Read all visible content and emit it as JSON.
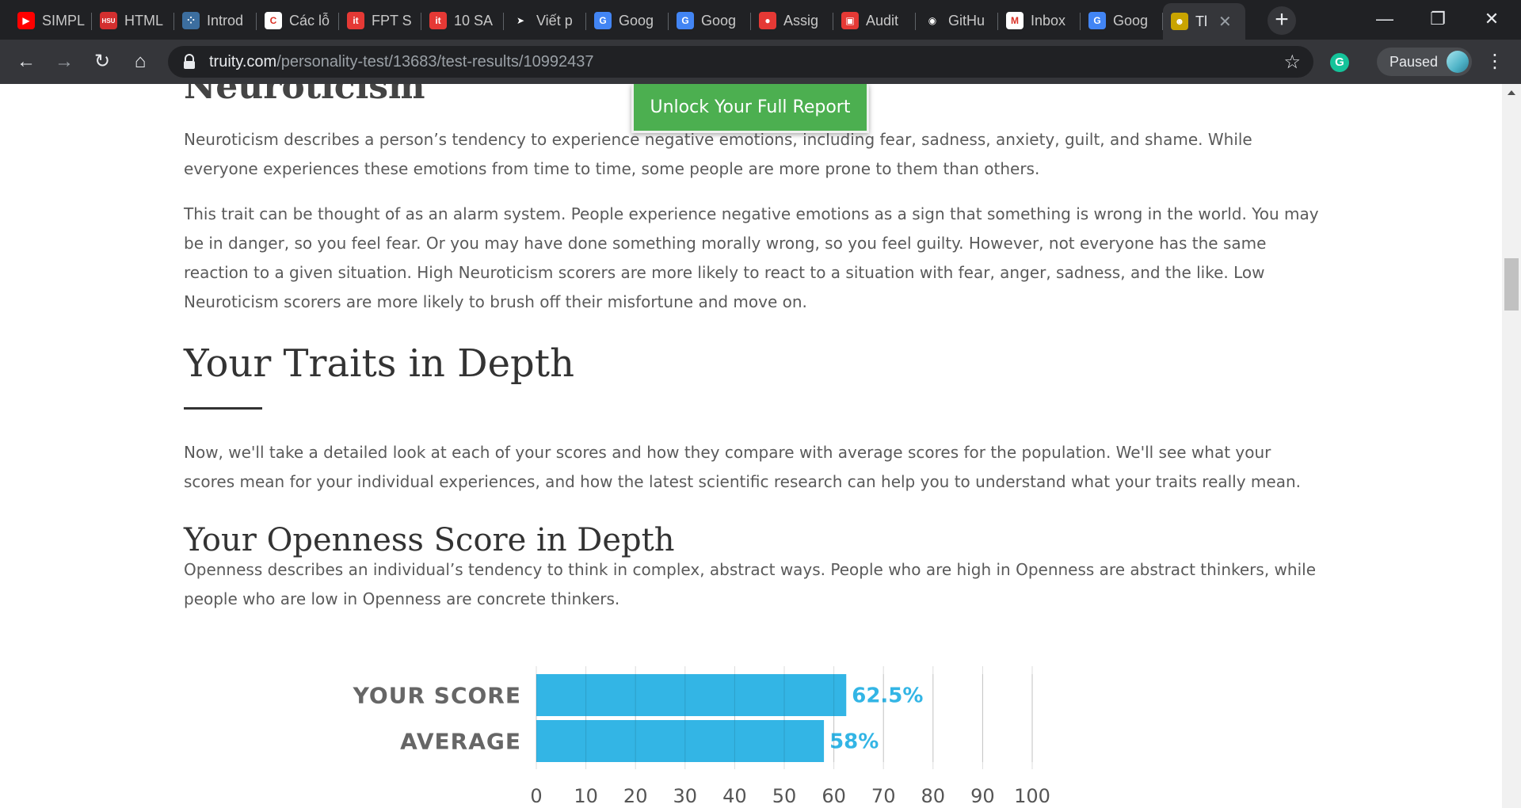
{
  "browser": {
    "tabs": [
      {
        "title": "SIMPL",
        "icon": "youtube-icon",
        "color": "#ff0000",
        "glyph": "▶"
      },
      {
        "title": "HTML",
        "icon": "hsu-icon",
        "color": "#d32f2f",
        "glyph": "HSU"
      },
      {
        "title": "Introd",
        "icon": "dots-icon",
        "color": "#3c6e9f",
        "glyph": "⁘"
      },
      {
        "title": "Các lỗ",
        "icon": "chrome-c-icon",
        "color": "#ffffff",
        "glyph": "C"
      },
      {
        "title": "FPT S",
        "icon": "it-icon",
        "color": "#e53935",
        "glyph": "it"
      },
      {
        "title": "10 SA",
        "icon": "it-icon",
        "color": "#e53935",
        "glyph": "it"
      },
      {
        "title": "Viết p",
        "icon": "cursor-icon",
        "color": "#202124",
        "glyph": "➤"
      },
      {
        "title": "Goog",
        "icon": "google-translate-icon",
        "color": "#4285f4",
        "glyph": "G"
      },
      {
        "title": "Goog",
        "icon": "google-translate-icon",
        "color": "#4285f4",
        "glyph": "G"
      },
      {
        "title": "Assig",
        "icon": "assignment-icon",
        "color": "#e53935",
        "glyph": "●"
      },
      {
        "title": "Audit",
        "icon": "gift-icon",
        "color": "#e53935",
        "glyph": "▣"
      },
      {
        "title": "GitHu",
        "icon": "github-icon",
        "color": "#202124",
        "glyph": "◉"
      },
      {
        "title": "Inbox",
        "icon": "gmail-icon",
        "color": "#ffffff",
        "glyph": "M"
      },
      {
        "title": "Goog",
        "icon": "google-translate-icon",
        "color": "#4285f4",
        "glyph": "G"
      },
      {
        "title": "Tl",
        "icon": "truity-icon",
        "color": "#c9a400",
        "glyph": "☻",
        "active": true
      }
    ],
    "url_domain": "truity.com",
    "url_path": "/personality-test/13683/test-results/10992437",
    "profile_status": "Paused"
  },
  "page": {
    "neuroticism_heading": "Neuroticism",
    "unlock_button": "Unlock Your Full Report",
    "neuroticism_p1": "Neuroticism describes a person’s tendency to experience negative emotions, including fear, sadness, anxiety, guilt, and shame. While everyone experiences these emotions from time to time, some people are more prone to them than others.",
    "neuroticism_p2": "This trait can be thought of as an alarm system. People experience negative emotions as a sign that something is wrong in the world. You may be in danger, so you feel fear. Or you may have done something morally wrong, so you feel guilty. However, not everyone has the same reaction to a given situation. High Neuroticism scorers are more likely to react to a situation with fear, anger, sadness, and the like. Low Neuroticism scorers are more likely to brush off their misfortune and move on.",
    "traits_heading": "Your Traits in Depth",
    "traits_p": "Now, we'll take a detailed look at each of your scores and how they compare with average scores for the population. We'll see what your scores mean for your individual experiences, and how the latest scientific research can help you to understand what your traits really mean.",
    "openness_heading": "Your Openness Score in Depth",
    "openness_p": "Openness describes an individual’s tendency to think in complex, abstract ways. People who are high in Openness are abstract thinkers, while people who are low in Openness are concrete thinkers."
  },
  "chart_data": {
    "type": "bar",
    "orientation": "horizontal",
    "categories": [
      "YOUR SCORE",
      "AVERAGE"
    ],
    "values": [
      62.5,
      58
    ],
    "value_labels": [
      "62.5%",
      "58%"
    ],
    "xlim": [
      0,
      100
    ],
    "xticks": [
      0,
      10,
      20,
      30,
      40,
      50,
      60,
      70,
      80,
      90,
      100
    ],
    "grid": true,
    "bar_color": "#33b5e5",
    "label_color": "#666666",
    "value_label_color": "#33b5e5"
  }
}
